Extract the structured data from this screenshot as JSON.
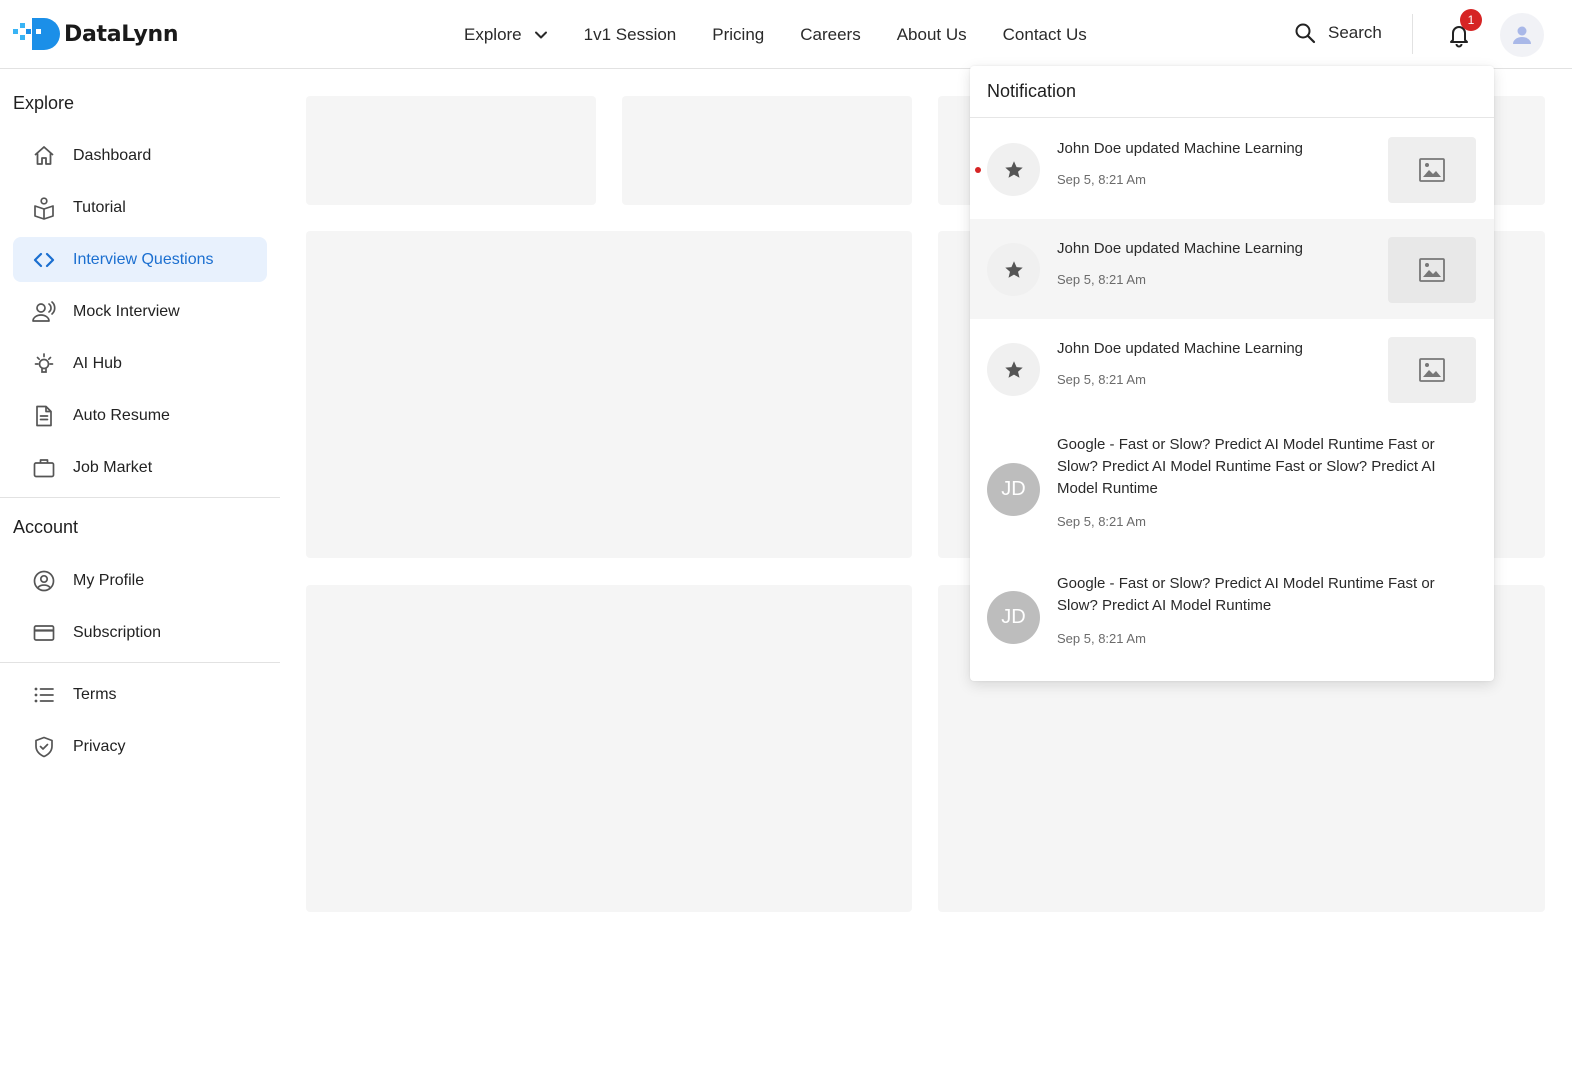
{
  "brand": {
    "name": "DataLynn",
    "primary_color": "#1b8fe8",
    "accent_color": "#1b6fd0"
  },
  "nav": {
    "items": [
      {
        "label": "Explore",
        "has_dropdown": true
      },
      {
        "label": "1v1 Session"
      },
      {
        "label": "Pricing"
      },
      {
        "label": "Careers"
      },
      {
        "label": "About Us"
      },
      {
        "label": "Contact Us"
      }
    ],
    "search_label": "Search",
    "notification_count": "1"
  },
  "sidebar": {
    "explore_title": "Explore",
    "explore_items": [
      {
        "label": "Dashboard",
        "icon": "home-icon"
      },
      {
        "label": "Tutorial",
        "icon": "tutorial-icon"
      },
      {
        "label": "Interview Questions",
        "icon": "code-icon",
        "active": true
      },
      {
        "label": "Mock Interview",
        "icon": "mock-interview-icon"
      },
      {
        "label": "AI Hub",
        "icon": "lightbulb-icon"
      },
      {
        "label": "Auto Resume",
        "icon": "document-icon"
      },
      {
        "label": "Job Market",
        "icon": "briefcase-icon"
      }
    ],
    "account_title": "Account",
    "account_items": [
      {
        "label": "My Profile",
        "icon": "user-circle-icon"
      },
      {
        "label": "Subscription",
        "icon": "credit-card-icon"
      }
    ],
    "legal_items": [
      {
        "label": "Terms",
        "icon": "list-icon"
      },
      {
        "label": "Privacy",
        "icon": "shield-icon"
      }
    ]
  },
  "notifications": {
    "title": "Notification",
    "items": [
      {
        "text": "John Doe updated Machine Learning",
        "time": "Sep 5, 8:21 Am",
        "avatar": "star-icon",
        "unread": true,
        "thumbnail": "image-icon"
      },
      {
        "text": "John Doe updated Machine Learning",
        "time": "Sep 5, 8:21 Am",
        "avatar": "star-icon",
        "highlighted": true,
        "thumbnail": "image-icon"
      },
      {
        "text": "John Doe updated Machine Learning",
        "time": "Sep 5, 8:21 Am",
        "avatar": "star-icon",
        "thumbnail": "image-icon"
      },
      {
        "text": "Google - Fast or Slow? Predict AI Model Runtime Fast or Slow? Predict AI Model Runtime Fast or Slow? Predict AI Model Runtime",
        "time": "Sep 5, 8:21 Am",
        "avatar_initials": "JD"
      },
      {
        "text": "Google - Fast or Slow? Predict AI Model Runtime Fast or Slow? Predict AI Model Runtime",
        "time": "Sep 5, 8:21 Am",
        "avatar_initials": "JD"
      }
    ]
  }
}
